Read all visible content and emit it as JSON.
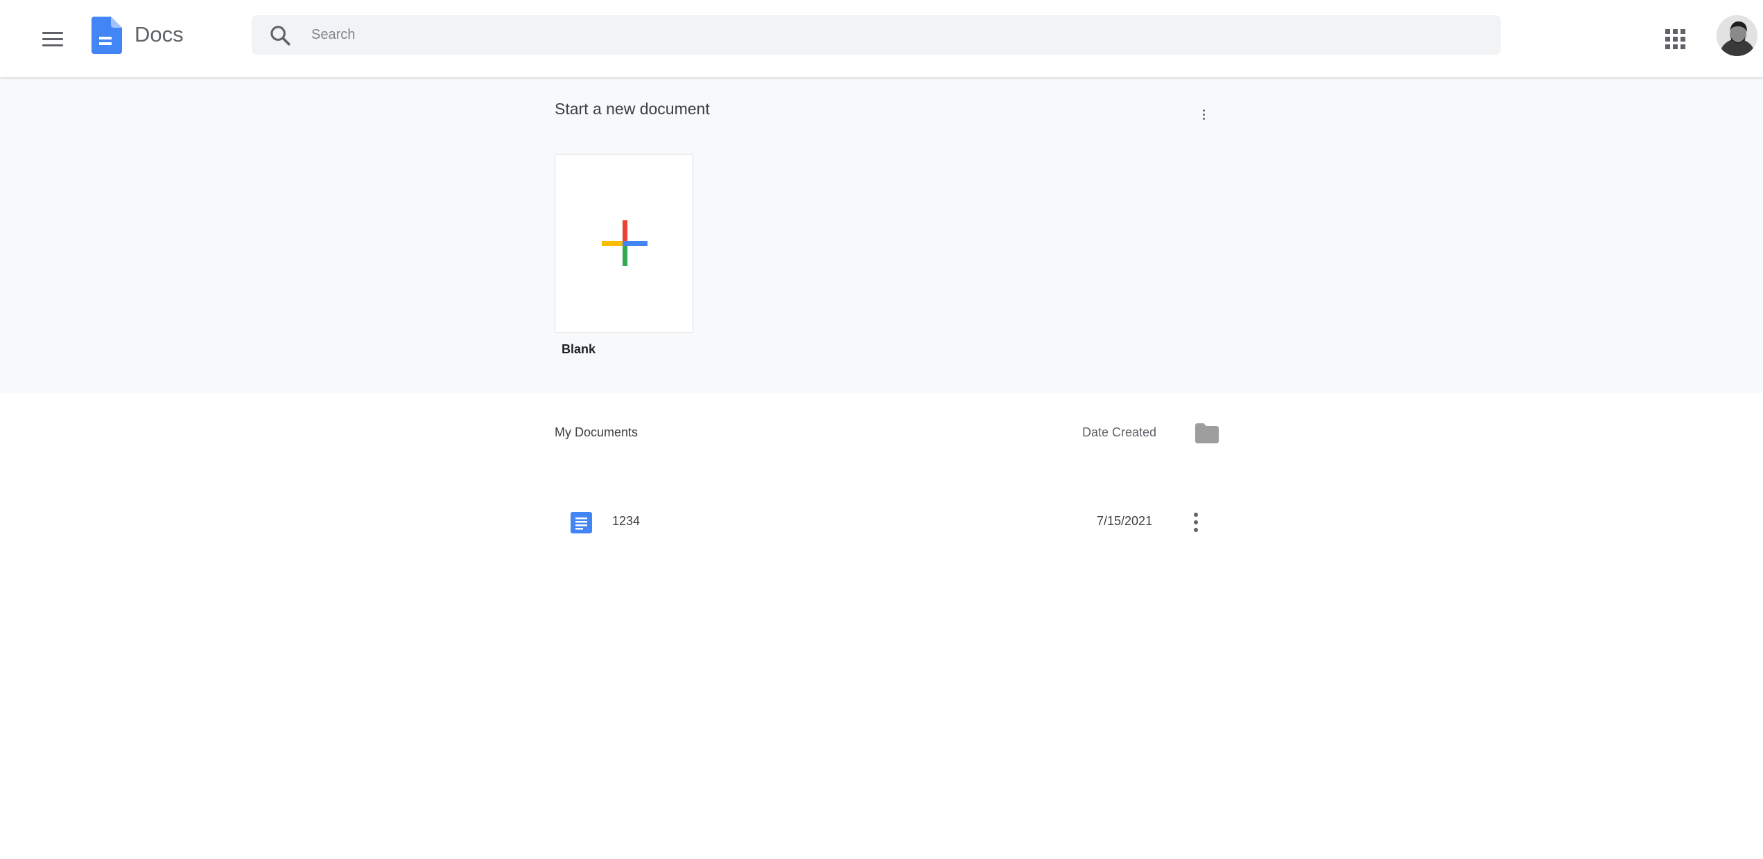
{
  "header": {
    "app_title": "Docs",
    "search_placeholder": "Search",
    "search_value": ""
  },
  "new_document": {
    "title": "Start a new document",
    "templates": [
      {
        "label": "Blank"
      }
    ]
  },
  "documents": {
    "title": "My Documents",
    "sort_label": "Date Created",
    "items": [
      {
        "name": "1234",
        "date": "7/15/2021"
      }
    ]
  },
  "icons": {
    "menu": "hamburger-menu-icon",
    "logo": "docs-logo-icon",
    "search": "search-icon",
    "apps": "apps-grid-icon",
    "avatar": "user-avatar",
    "more": "more-vert-icon",
    "add": "plus-icon",
    "folder": "folder-icon",
    "doc": "document-icon"
  },
  "colors": {
    "brand_blue": "#4285f4",
    "plus_red": "#ea4335",
    "plus_yellow": "#fbbc04",
    "plus_green": "#34a853",
    "band_background": "#f8f9fa"
  }
}
